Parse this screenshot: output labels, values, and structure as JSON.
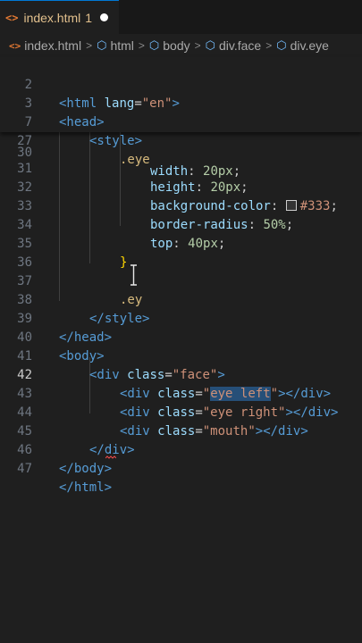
{
  "tab": {
    "icon": "html-file-icon",
    "name": "index.html",
    "problem_count": "1",
    "modified_indicator": "unsaved-dot"
  },
  "breadcrumb": {
    "file": "index.html",
    "items": [
      "html",
      "body",
      "div.face",
      "div.eye"
    ]
  },
  "sticky_lines": [
    {
      "number": "2",
      "text": "<html lang=\"en\">"
    },
    {
      "number": "3",
      "text": "<head>"
    },
    {
      "number": "7",
      "text": "<style>"
    },
    {
      "number": "27",
      "text": ".eye"
    }
  ],
  "lines": [
    {
      "number": "30",
      "text": "width: 20px;"
    },
    {
      "number": "31",
      "text": "height: 20px;"
    },
    {
      "number": "32",
      "text": "background-color: #333;"
    },
    {
      "number": "33",
      "text": "border-radius: 50%;"
    },
    {
      "number": "34",
      "text": "top: 40px;"
    },
    {
      "number": "35",
      "text": "}"
    },
    {
      "number": "36",
      "text": ""
    },
    {
      "number": "37",
      "text": ".ey"
    },
    {
      "number": "38",
      "text": "</style>"
    },
    {
      "number": "39",
      "text": "</head>"
    },
    {
      "number": "40",
      "text": "<body>"
    },
    {
      "number": "41",
      "text": "<div class=\"face\">"
    },
    {
      "number": "42",
      "text": "<div class=\"eye left\"></div>"
    },
    {
      "number": "43",
      "text": "<div class=\"eye right\"></div>"
    },
    {
      "number": "44",
      "text": "<div class=\"mouth\"></div>"
    },
    {
      "number": "45",
      "text": "</div>"
    },
    {
      "number": "46",
      "text": "</body>"
    },
    {
      "number": "47",
      "text": "</html>"
    }
  ],
  "active_line": "42",
  "selection": "eye left",
  "colors": {
    "background": "#1f1f1f",
    "tag": "#569cd6",
    "attribute": "#9cdcfe",
    "string": "#ce9178",
    "selector": "#d7ba7d",
    "number": "#b5cea8",
    "bracket": "#ffd700",
    "selection": "#264f78",
    "modified_tab": "#e2c08d"
  }
}
